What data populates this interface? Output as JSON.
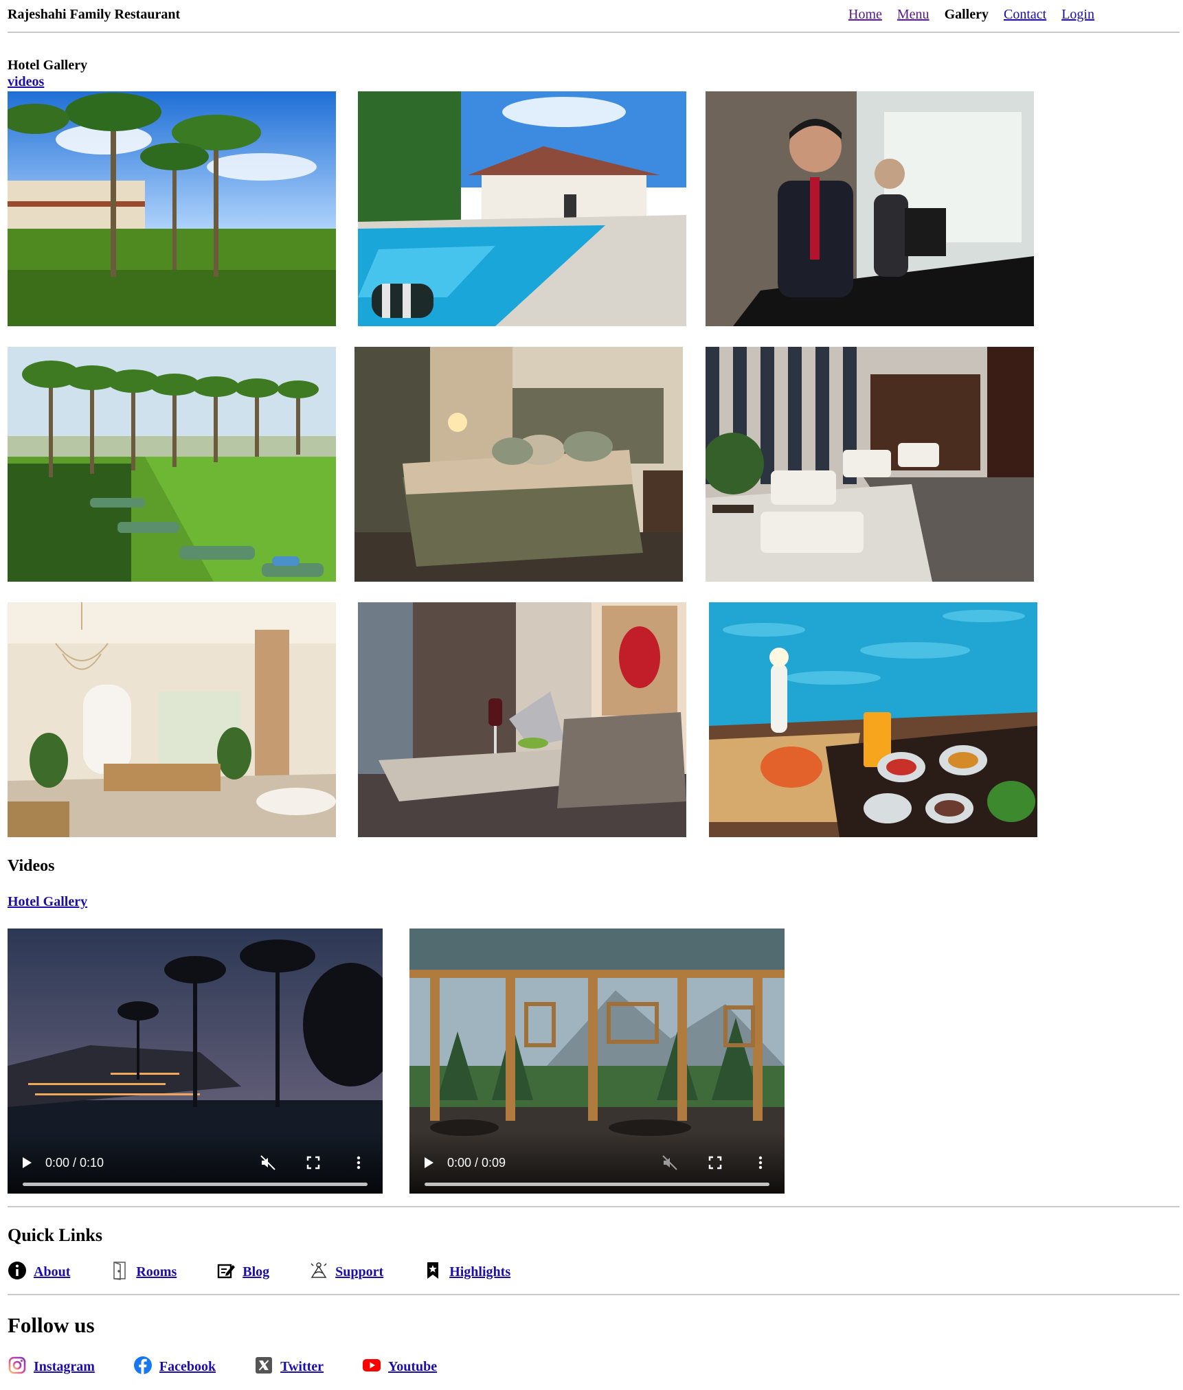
{
  "header": {
    "brand": "Rajeshahi Family Restaurant",
    "nav": [
      {
        "label": "Home",
        "state": "visited"
      },
      {
        "label": "Menu",
        "state": "visited"
      },
      {
        "label": "Gallery",
        "state": "current"
      },
      {
        "label": "Contact",
        "state": "link"
      },
      {
        "label": "Login",
        "state": "link"
      }
    ]
  },
  "gallery": {
    "title": "Hotel Gallery",
    "videos_link": "videos"
  },
  "videos": {
    "heading": "Videos",
    "gallery_link": "Hotel Gallery",
    "players": [
      {
        "time": "0:00 / 0:10",
        "muted_icon": "volume-muted-icon"
      },
      {
        "time": "0:00 / 0:09",
        "muted_icon": "volume-muted-icon"
      }
    ]
  },
  "quick_links": {
    "heading": "Quick Links",
    "items": [
      {
        "label": "About",
        "icon": "info-icon"
      },
      {
        "label": "Rooms",
        "icon": "door-icon"
      },
      {
        "label": "Blog",
        "icon": "edit-note-icon"
      },
      {
        "label": "Support",
        "icon": "support-icon"
      },
      {
        "label": "Highlights",
        "icon": "bookmark-star-icon"
      }
    ]
  },
  "follow_us": {
    "heading": "Follow us",
    "items": [
      {
        "label": "Instagram",
        "icon": "instagram-icon",
        "color": "#d6249f"
      },
      {
        "label": "Facebook",
        "icon": "facebook-icon",
        "color": "#1877f2"
      },
      {
        "label": "Twitter",
        "icon": "x-twitter-icon",
        "color": "#000000"
      },
      {
        "label": "Youtube",
        "icon": "youtube-icon",
        "color": "#ff0000"
      }
    ]
  }
}
